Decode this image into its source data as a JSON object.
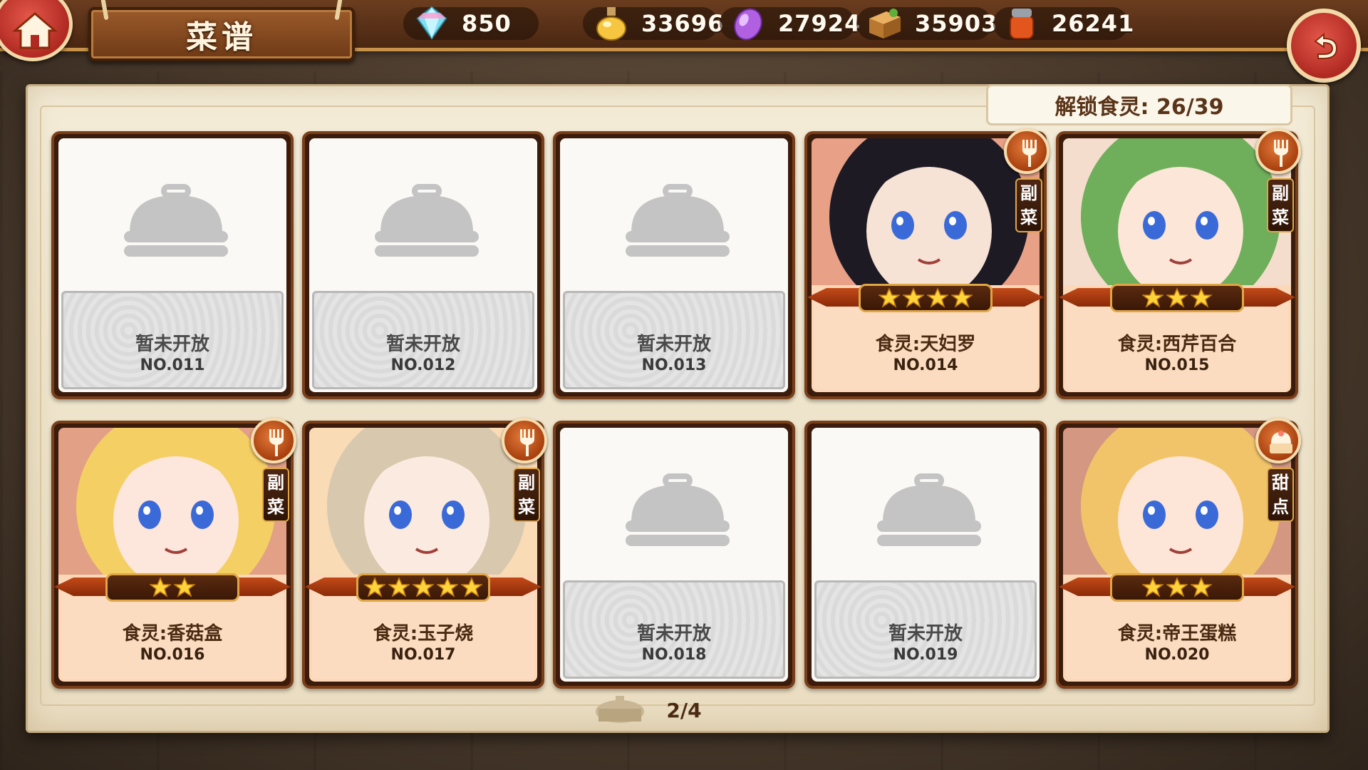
{
  "screen": {
    "title": "菜谱",
    "unlock_text": "解锁食灵: 26/39",
    "page": "2/4"
  },
  "resources": [
    {
      "icon": "diamond-icon",
      "value": "850"
    },
    {
      "icon": "potion-icon",
      "value": "33696"
    },
    {
      "icon": "purple-crystal-icon",
      "value": "27924"
    },
    {
      "icon": "crate-icon",
      "value": "35903"
    },
    {
      "icon": "spice-jar-icon",
      "value": "26241"
    }
  ],
  "colors": {
    "locked_plate": "#dedede",
    "open_plate": "#fcdcc0",
    "frame": "#7a3e18",
    "badge": "#c8551e"
  },
  "cards": [
    {
      "locked": true,
      "name": "暂未开放",
      "number": "NO.011"
    },
    {
      "locked": true,
      "name": "暂未开放",
      "number": "NO.012"
    },
    {
      "locked": true,
      "name": "暂未开放",
      "number": "NO.013"
    },
    {
      "locked": false,
      "name": "食灵:天妇罗",
      "number": "NO.014",
      "stars": 4,
      "tag": [
        "副",
        "菜"
      ],
      "badge": "fork-icon",
      "portrait_colors": [
        "#1d1a24",
        "#f7e2d6",
        "#c43a2c"
      ]
    },
    {
      "locked": false,
      "name": "食灵:西芹百合",
      "number": "NO.015",
      "stars": 3,
      "tag": [
        "副",
        "菜"
      ],
      "badge": "fork-icon",
      "portrait_colors": [
        "#6fae5a",
        "#fbe6d8",
        "#e6e8f0"
      ]
    },
    {
      "locked": false,
      "name": "食灵:香菇盒",
      "number": "NO.016",
      "stars": 2,
      "tag": [
        "副",
        "菜"
      ],
      "badge": "fork-icon",
      "portrait_colors": [
        "#f4cf64",
        "#fde6dc",
        "#b23a2a"
      ]
    },
    {
      "locked": false,
      "name": "食灵:玉子烧",
      "number": "NO.017",
      "stars": 5,
      "tag": [
        "副",
        "菜"
      ],
      "badge": "fork-icon",
      "portrait_colors": [
        "#d8c8ae",
        "#fbeadf",
        "#f4e3b0"
      ]
    },
    {
      "locked": true,
      "name": "暂未开放",
      "number": "NO.018"
    },
    {
      "locked": true,
      "name": "暂未开放",
      "number": "NO.019"
    },
    {
      "locked": false,
      "name": "食灵:帝王蛋糕",
      "number": "NO.020",
      "stars": 3,
      "tag": [
        "甜",
        "点"
      ],
      "badge": "cake-icon",
      "portrait_colors": [
        "#f2c46a",
        "#fde6d8",
        "#8a1f1a"
      ]
    }
  ]
}
